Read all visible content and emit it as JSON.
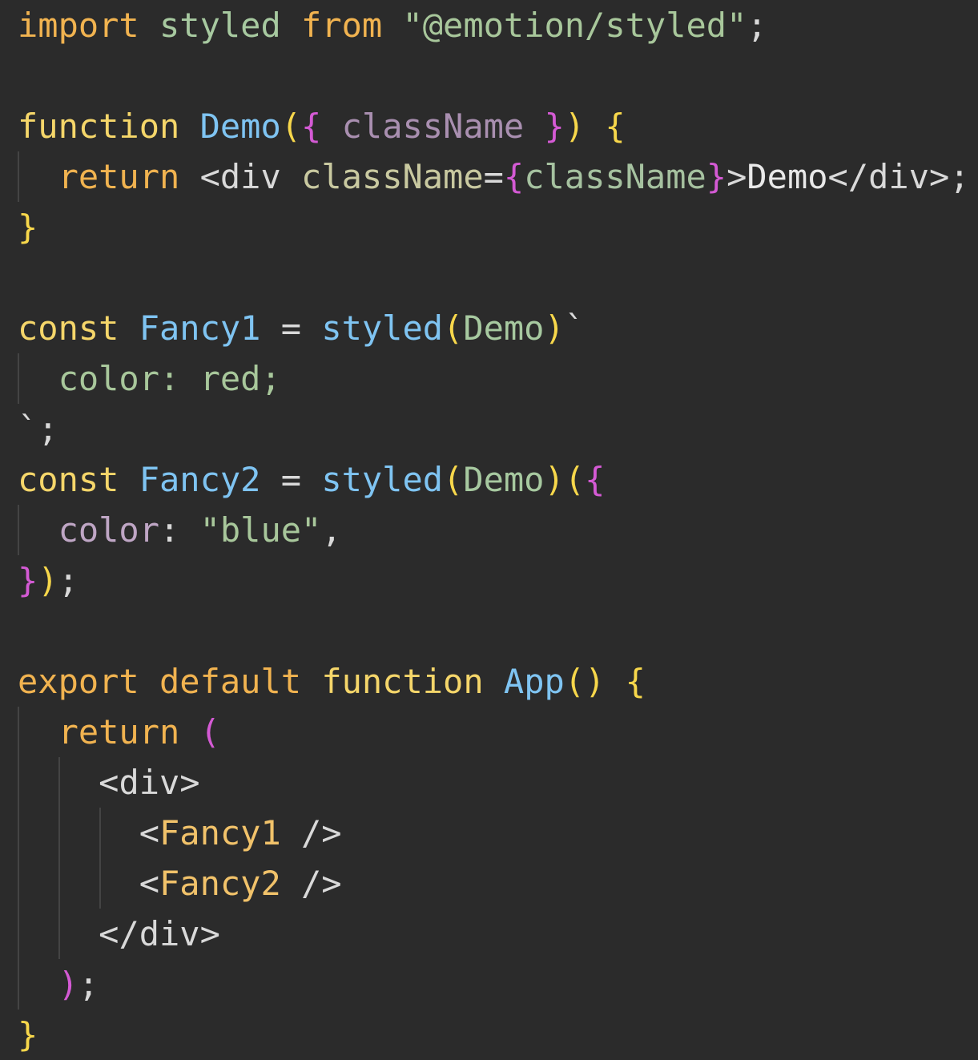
{
  "editor": {
    "lines": [
      [
        {
          "t": "import",
          "c": "c-kw"
        },
        {
          "t": " ",
          "c": "c-punc"
        },
        {
          "t": "styled",
          "c": "c-ident"
        },
        {
          "t": " ",
          "c": "c-punc"
        },
        {
          "t": "from",
          "c": "c-kw"
        },
        {
          "t": " ",
          "c": "c-punc"
        },
        {
          "t": "\"@emotion/styled\"",
          "c": "c-str"
        },
        {
          "t": ";",
          "c": "c-punc"
        }
      ],
      [],
      [
        {
          "t": "function",
          "c": "c-ctl"
        },
        {
          "t": " ",
          "c": "c-punc"
        },
        {
          "t": "Demo",
          "c": "c-fn"
        },
        {
          "t": "(",
          "c": "c-b1"
        },
        {
          "t": "{",
          "c": "c-b2"
        },
        {
          "t": " ",
          "c": "c-punc"
        },
        {
          "t": "className",
          "c": "c-param"
        },
        {
          "t": " ",
          "c": "c-punc"
        },
        {
          "t": "}",
          "c": "c-b2"
        },
        {
          "t": ")",
          "c": "c-b1"
        },
        {
          "t": " ",
          "c": "c-punc"
        },
        {
          "t": "{",
          "c": "c-b1"
        }
      ],
      [
        {
          "t": "  ",
          "c": "c-punc"
        },
        {
          "t": "return",
          "c": "c-kw"
        },
        {
          "t": " ",
          "c": "c-punc"
        },
        {
          "t": "<div",
          "c": "c-tag"
        },
        {
          "t": " ",
          "c": "c-punc"
        },
        {
          "t": "className",
          "c": "c-attr"
        },
        {
          "t": "=",
          "c": "c-punc"
        },
        {
          "t": "{",
          "c": "c-b2"
        },
        {
          "t": "className",
          "c": "c-prop"
        },
        {
          "t": "}",
          "c": "c-b2"
        },
        {
          "t": ">",
          "c": "c-tag"
        },
        {
          "t": "Demo",
          "c": "c-text"
        },
        {
          "t": "</div>",
          "c": "c-tag"
        },
        {
          "t": ";",
          "c": "c-punc"
        }
      ],
      [
        {
          "t": "}",
          "c": "c-b1"
        }
      ],
      [],
      [
        {
          "t": "const",
          "c": "c-ctl"
        },
        {
          "t": " ",
          "c": "c-punc"
        },
        {
          "t": "Fancy1",
          "c": "c-fn"
        },
        {
          "t": " = ",
          "c": "c-punc"
        },
        {
          "t": "styled",
          "c": "c-fn"
        },
        {
          "t": "(",
          "c": "c-b1"
        },
        {
          "t": "Demo",
          "c": "c-ident"
        },
        {
          "t": ")",
          "c": "c-b1"
        },
        {
          "t": "`",
          "c": "c-punc"
        }
      ],
      [
        {
          "t": "  ",
          "c": "c-punc"
        },
        {
          "t": "color: red;",
          "c": "c-str"
        }
      ],
      [
        {
          "t": "`;",
          "c": "c-punc"
        }
      ],
      [
        {
          "t": "const",
          "c": "c-ctl"
        },
        {
          "t": " ",
          "c": "c-punc"
        },
        {
          "t": "Fancy2",
          "c": "c-fn"
        },
        {
          "t": " = ",
          "c": "c-punc"
        },
        {
          "t": "styled",
          "c": "c-fn"
        },
        {
          "t": "(",
          "c": "c-b1"
        },
        {
          "t": "Demo",
          "c": "c-ident"
        },
        {
          "t": ")",
          "c": "c-b1"
        },
        {
          "t": "(",
          "c": "c-b1"
        },
        {
          "t": "{",
          "c": "c-b2"
        }
      ],
      [
        {
          "t": "  ",
          "c": "c-punc"
        },
        {
          "t": "color",
          "c": "c-prop2"
        },
        {
          "t": ": ",
          "c": "c-punc"
        },
        {
          "t": "\"blue\"",
          "c": "c-str"
        },
        {
          "t": ",",
          "c": "c-punc"
        }
      ],
      [
        {
          "t": "}",
          "c": "c-b2"
        },
        {
          "t": ")",
          "c": "c-b1"
        },
        {
          "t": ";",
          "c": "c-punc"
        }
      ],
      [],
      [
        {
          "t": "export",
          "c": "c-kw"
        },
        {
          "t": " ",
          "c": "c-punc"
        },
        {
          "t": "default",
          "c": "c-kw"
        },
        {
          "t": " ",
          "c": "c-punc"
        },
        {
          "t": "function",
          "c": "c-ctl"
        },
        {
          "t": " ",
          "c": "c-punc"
        },
        {
          "t": "App",
          "c": "c-fn"
        },
        {
          "t": "()",
          "c": "c-b1"
        },
        {
          "t": " ",
          "c": "c-punc"
        },
        {
          "t": "{",
          "c": "c-b1"
        }
      ],
      [
        {
          "t": "  ",
          "c": "c-punc"
        },
        {
          "t": "return",
          "c": "c-kw"
        },
        {
          "t": " ",
          "c": "c-punc"
        },
        {
          "t": "(",
          "c": "c-b2"
        }
      ],
      [
        {
          "t": "    ",
          "c": "c-punc"
        },
        {
          "t": "<div>",
          "c": "c-tag"
        }
      ],
      [
        {
          "t": "      ",
          "c": "c-punc"
        },
        {
          "t": "<",
          "c": "c-tag"
        },
        {
          "t": "Fancy1",
          "c": "c-comp"
        },
        {
          "t": " />",
          "c": "c-tag"
        }
      ],
      [
        {
          "t": "      ",
          "c": "c-punc"
        },
        {
          "t": "<",
          "c": "c-tag"
        },
        {
          "t": "Fancy2",
          "c": "c-comp"
        },
        {
          "t": " />",
          "c": "c-tag"
        }
      ],
      [
        {
          "t": "    ",
          "c": "c-punc"
        },
        {
          "t": "</div>",
          "c": "c-tag"
        }
      ],
      [
        {
          "t": "  ",
          "c": "c-punc"
        },
        {
          "t": ")",
          "c": "c-b2"
        },
        {
          "t": ";",
          "c": "c-punc"
        }
      ],
      [
        {
          "t": "}",
          "c": "c-b1"
        }
      ]
    ]
  }
}
